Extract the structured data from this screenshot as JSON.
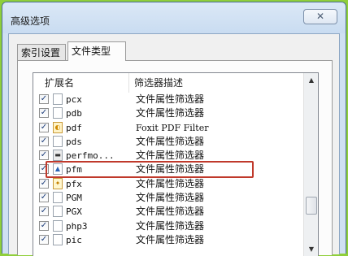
{
  "dialog": {
    "title": "高级选项",
    "close_glyph": "✕"
  },
  "tabs": [
    {
      "label": "索引设置"
    },
    {
      "label": "文件类型"
    }
  ],
  "list": {
    "columns": [
      "扩展名",
      "筛选器描述"
    ],
    "rows": [
      {
        "checked": true,
        "icon": "blank-file-icon",
        "ext": "pcx",
        "desc": "文件属性筛选器"
      },
      {
        "checked": true,
        "icon": "blank-file-icon",
        "ext": "pdb",
        "desc": "文件属性筛选器"
      },
      {
        "checked": true,
        "icon": "foxit-pdf-icon",
        "ext": "pdf",
        "desc": "Foxit PDF Filter"
      },
      {
        "checked": true,
        "icon": "blank-file-icon",
        "ext": "pds",
        "desc": "文件属性筛选器"
      },
      {
        "checked": true,
        "icon": "app-file-icon",
        "ext": "perfmo...",
        "desc": "文件属性筛选器"
      },
      {
        "checked": true,
        "icon": "image-file-icon",
        "ext": "pfm",
        "desc": "文件属性筛选器"
      },
      {
        "checked": true,
        "icon": "certificate-file-icon",
        "ext": "pfx",
        "desc": "文件属性筛选器"
      },
      {
        "checked": true,
        "icon": "blank-file-icon",
        "ext": "PGM",
        "desc": "文件属性筛选器"
      },
      {
        "checked": true,
        "icon": "blank-file-icon",
        "ext": "PGX",
        "desc": "文件属性筛选器"
      },
      {
        "checked": true,
        "icon": "blank-file-icon",
        "ext": "php3",
        "desc": "文件属性筛选器"
      },
      {
        "checked": true,
        "icon": "blank-file-icon",
        "ext": "pic",
        "desc": "文件属性筛选器"
      }
    ],
    "checkbox_glyph": "✓",
    "scroll_up_glyph": "▲",
    "scroll_down_glyph": "▼"
  },
  "colors": {
    "highlight": "#c0392b",
    "background": "#8fcf3a"
  }
}
